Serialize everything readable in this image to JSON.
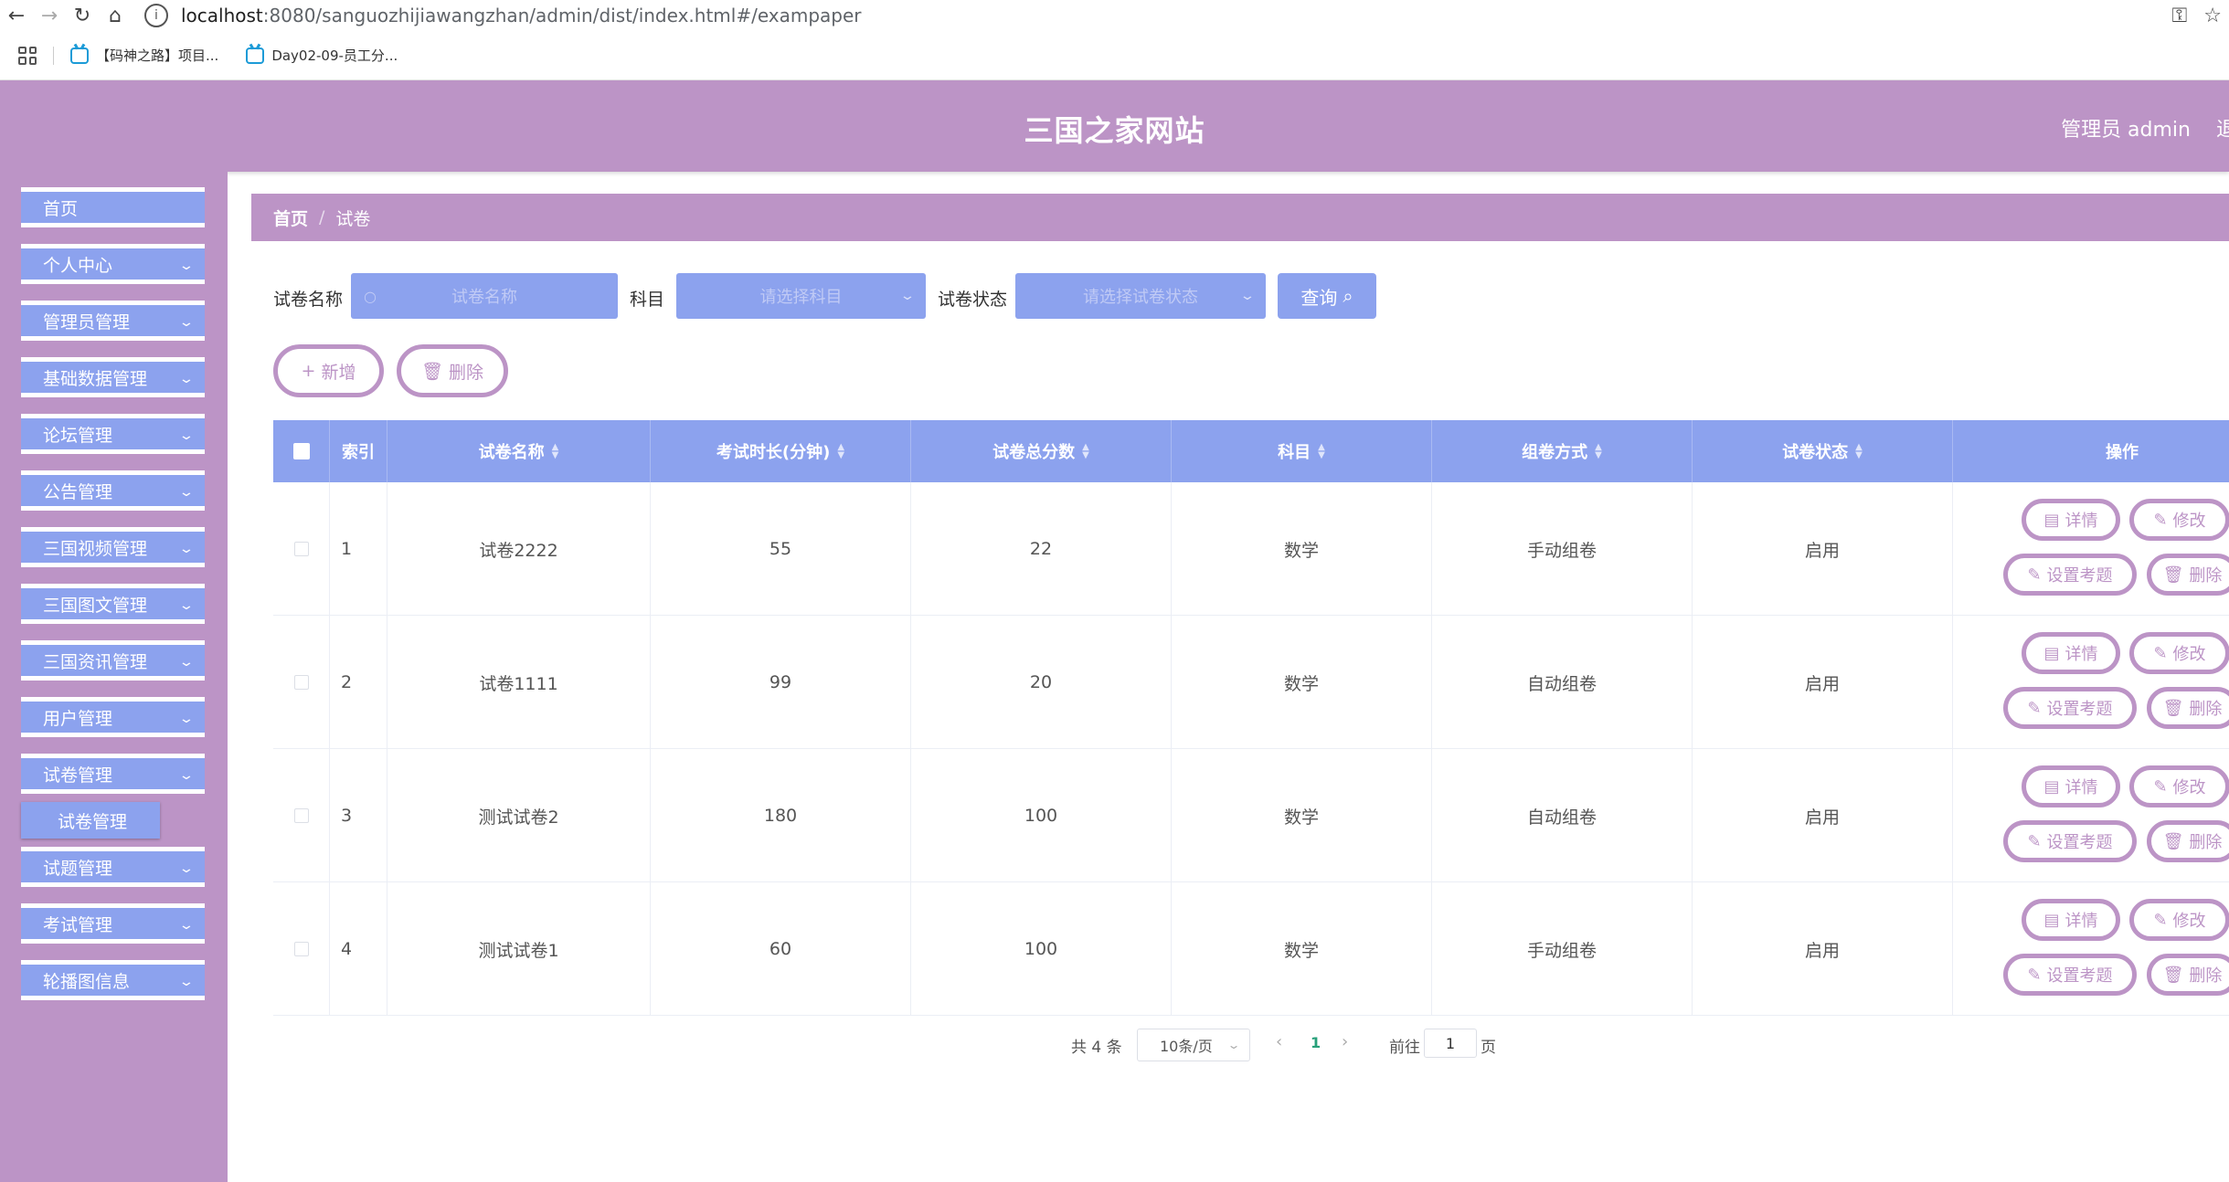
{
  "browser": {
    "url_host": "localhost",
    "url_path": ":8080/sanguozhijiawangzhan/admin/dist/index.html#/exampaper",
    "bookmarks": [
      "【码神之路】项目...",
      "Day02-09-员工分..."
    ]
  },
  "header": {
    "title": "三国之家网站",
    "user": "管理员 admin",
    "logout": "退"
  },
  "sidebar": {
    "items": [
      {
        "label": "首页"
      },
      {
        "label": "个人中心"
      },
      {
        "label": "管理员管理"
      },
      {
        "label": "基础数据管理"
      },
      {
        "label": "论坛管理"
      },
      {
        "label": "公告管理"
      },
      {
        "label": "三国视频管理"
      },
      {
        "label": "三国图文管理"
      },
      {
        "label": "三国资讯管理"
      },
      {
        "label": "用户管理"
      },
      {
        "label": "试卷管理"
      },
      {
        "label": "试题管理"
      },
      {
        "label": "考试管理"
      },
      {
        "label": "轮播图信息"
      }
    ],
    "active_sub": "试卷管理"
  },
  "breadcrumb": {
    "home": "首页",
    "sep": "/",
    "current": "试卷"
  },
  "search": {
    "name_label": "试卷名称",
    "name_placeholder": "试卷名称",
    "subject_label": "科目",
    "subject_placeholder": "请选择科目",
    "status_label": "试卷状态",
    "status_placeholder": "请选择试卷状态",
    "query_label": "查询"
  },
  "actions": {
    "add_label": "新增",
    "delete_label": "删除"
  },
  "table": {
    "headers": {
      "index": "索引",
      "name": "试卷名称",
      "duration": "考试时长(分钟)",
      "total": "试卷总分数",
      "subject": "科目",
      "mode": "组卷方式",
      "status": "试卷状态",
      "ops": "操作"
    },
    "rows": [
      {
        "index": "1",
        "name": "试卷2222",
        "duration": "55",
        "total": "22",
        "subject": "数学",
        "mode": "手动组卷",
        "status": "启用"
      },
      {
        "index": "2",
        "name": "试卷1111",
        "duration": "99",
        "total": "20",
        "subject": "数学",
        "mode": "自动组卷",
        "status": "启用"
      },
      {
        "index": "3",
        "name": "测试试卷2",
        "duration": "180",
        "total": "100",
        "subject": "数学",
        "mode": "自动组卷",
        "status": "启用"
      },
      {
        "index": "4",
        "name": "测试试卷1",
        "duration": "60",
        "total": "100",
        "subject": "数学",
        "mode": "手动组卷",
        "status": "启用"
      }
    ],
    "row_ops": {
      "detail": "详情",
      "edit": "修改",
      "set_questions": "设置考题",
      "delete": "删除"
    }
  },
  "pagination": {
    "total": "共 4 条",
    "page_size": "10条/页",
    "current_page": "1",
    "goto_label": "前往",
    "goto_value": "1",
    "page_suffix": "页"
  },
  "colors": {
    "header_bg": "#bc94c6",
    "accent_blue": "#8ca2ee",
    "active_page": "#27a07a"
  }
}
